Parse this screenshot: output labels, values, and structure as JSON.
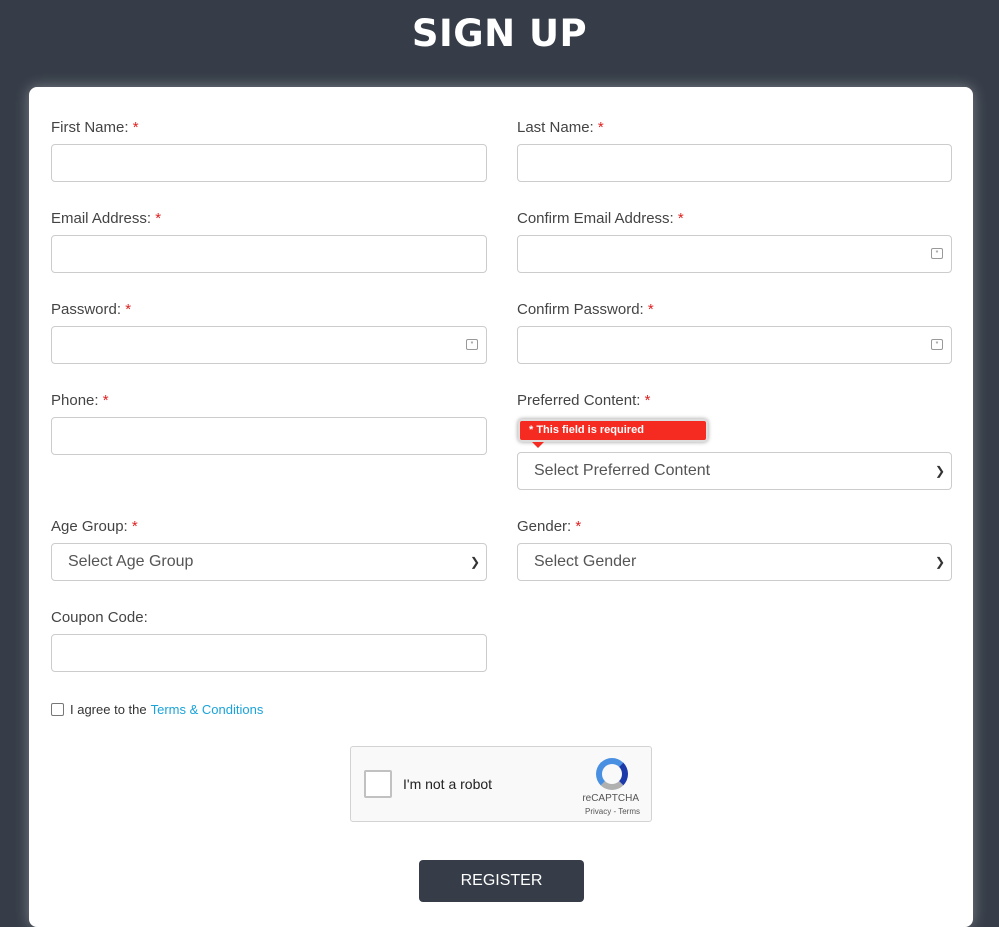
{
  "title": "SIGN UP",
  "fields": {
    "first_name": "First Name:",
    "last_name": "Last Name:",
    "email": "Email Address:",
    "confirm_email": "Confirm Email Address:",
    "password": "Password:",
    "confirm_password": "Confirm Password:",
    "phone": "Phone:",
    "preferred": "Preferred Content:",
    "age": "Age Group:",
    "gender": "Gender:",
    "coupon": "Coupon Code:"
  },
  "required_mark": "*",
  "selects": {
    "preferred": "Select Preferred Content",
    "age": "Select Age Group",
    "gender": "Select Gender"
  },
  "error_tooltip": "* This field is required",
  "agree": {
    "text": "I agree to the",
    "link": "Terms & Conditions"
  },
  "recaptcha": {
    "label": "I'm not a robot",
    "brand": "reCAPTCHA",
    "links": "Privacy - Terms"
  },
  "register_label": "REGISTER",
  "colors": {
    "background": "#363d48",
    "error": "#f52b22",
    "link": "#1aa3d9"
  }
}
